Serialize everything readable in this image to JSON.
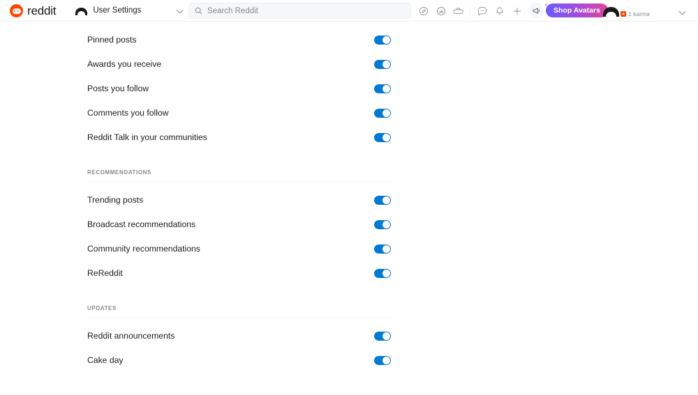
{
  "header": {
    "logo_text": "reddit",
    "logo_icon": "reddit-snoo-icon",
    "switcher_label": "User Settings",
    "switcher_avatar_icon": "avatar-icon",
    "switcher_chevron_icon": "chevron-down-icon",
    "search": {
      "placeholder": "Search Reddit",
      "value": "",
      "icon": "search-icon"
    },
    "nav_icons": [
      {
        "name": "explore-icon",
        "title": "Explore"
      },
      {
        "name": "popular-icon",
        "title": "Popular"
      },
      {
        "name": "gaming-icon",
        "title": "Gaming"
      },
      {
        "name": "chat-icon",
        "title": "Chat"
      },
      {
        "name": "notifications-bell-icon",
        "title": "Notifications"
      },
      {
        "name": "create-post-plus-icon",
        "title": "Create Post"
      }
    ],
    "megaphone_icon": "megaphone-icon",
    "shop_avatars_label": "Shop Avatars",
    "user": {
      "avatar_icon": "user-avatar-icon",
      "karma": "1 karma",
      "karma_icon": "karma-icon",
      "chevron_icon": "chevron-down-icon"
    }
  },
  "main": {
    "top_section": {
      "rows": [
        {
          "label": "Pinned posts",
          "enabled": true
        },
        {
          "label": "Awards you receive",
          "enabled": true
        },
        {
          "label": "Posts you follow",
          "enabled": true
        },
        {
          "label": "Comments you follow",
          "enabled": true
        },
        {
          "label": "Reddit Talk in your communities",
          "enabled": true
        }
      ]
    },
    "sections": [
      {
        "title": "RECOMMENDATIONS",
        "rows": [
          {
            "label": "Trending posts",
            "enabled": true
          },
          {
            "label": "Broadcast recommendations",
            "enabled": true
          },
          {
            "label": "Community recommendations",
            "enabled": true
          },
          {
            "label": "ReReddit",
            "enabled": true
          }
        ]
      },
      {
        "title": "UPDATES",
        "rows": [
          {
            "label": "Reddit announcements",
            "enabled": true
          },
          {
            "label": "Cake day",
            "enabled": true
          }
        ]
      }
    ]
  },
  "colors": {
    "brand_orange": "#ff4500",
    "toggle_on": "#0079d3",
    "text_primary": "#1c1c1c",
    "text_muted": "#878a8c",
    "divider": "#edeff1"
  }
}
